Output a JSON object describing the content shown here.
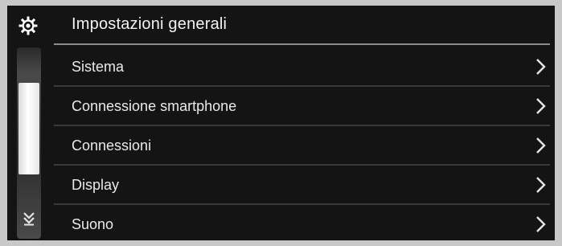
{
  "header": {
    "icon": "gear-icon",
    "title": "Impostazioni generali"
  },
  "scrollbar": {
    "down_icon": "double-chevron-down-icon"
  },
  "menu": {
    "items": [
      {
        "label": "Sistema",
        "icon": "chevron-right-icon"
      },
      {
        "label": "Connessione smartphone",
        "icon": "chevron-right-icon"
      },
      {
        "label": "Connessioni",
        "icon": "chevron-right-icon"
      },
      {
        "label": "Display",
        "icon": "chevron-right-icon"
      },
      {
        "label": "Suono",
        "icon": "chevron-right-icon"
      }
    ]
  },
  "colors": {
    "background": "#141414",
    "text": "#eaeaea",
    "divider": "#3a3a3a",
    "header_rule": "#8c8c8c"
  }
}
